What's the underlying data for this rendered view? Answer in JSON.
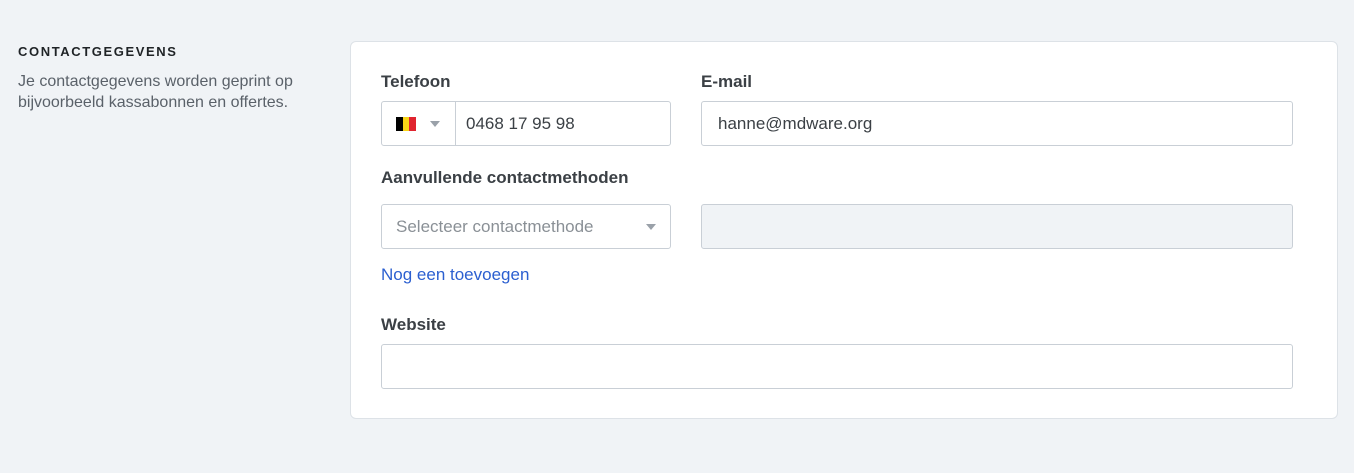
{
  "section": {
    "title": "CONTACTGEGEVENS",
    "description": "Je contactgegevens worden geprint op bijvoorbeeld kassabonnen en offertes."
  },
  "phone": {
    "label": "Telefoon",
    "country_flag_colors": [
      "#000000",
      "#f7d417",
      "#e0242f"
    ],
    "value": "0468 17 95 98"
  },
  "email": {
    "label": "E-mail",
    "value": "hanne@mdware.org"
  },
  "additional": {
    "label": "Aanvullende contactmethoden",
    "select_placeholder": "Selecteer contactmethode",
    "value": "",
    "add_link": "Nog een toevoegen"
  },
  "website": {
    "label": "Website",
    "value": ""
  },
  "colors": {
    "background": "#f0f3f6",
    "link": "#2b5fd0",
    "disabled_field": "#f0f3f6"
  }
}
